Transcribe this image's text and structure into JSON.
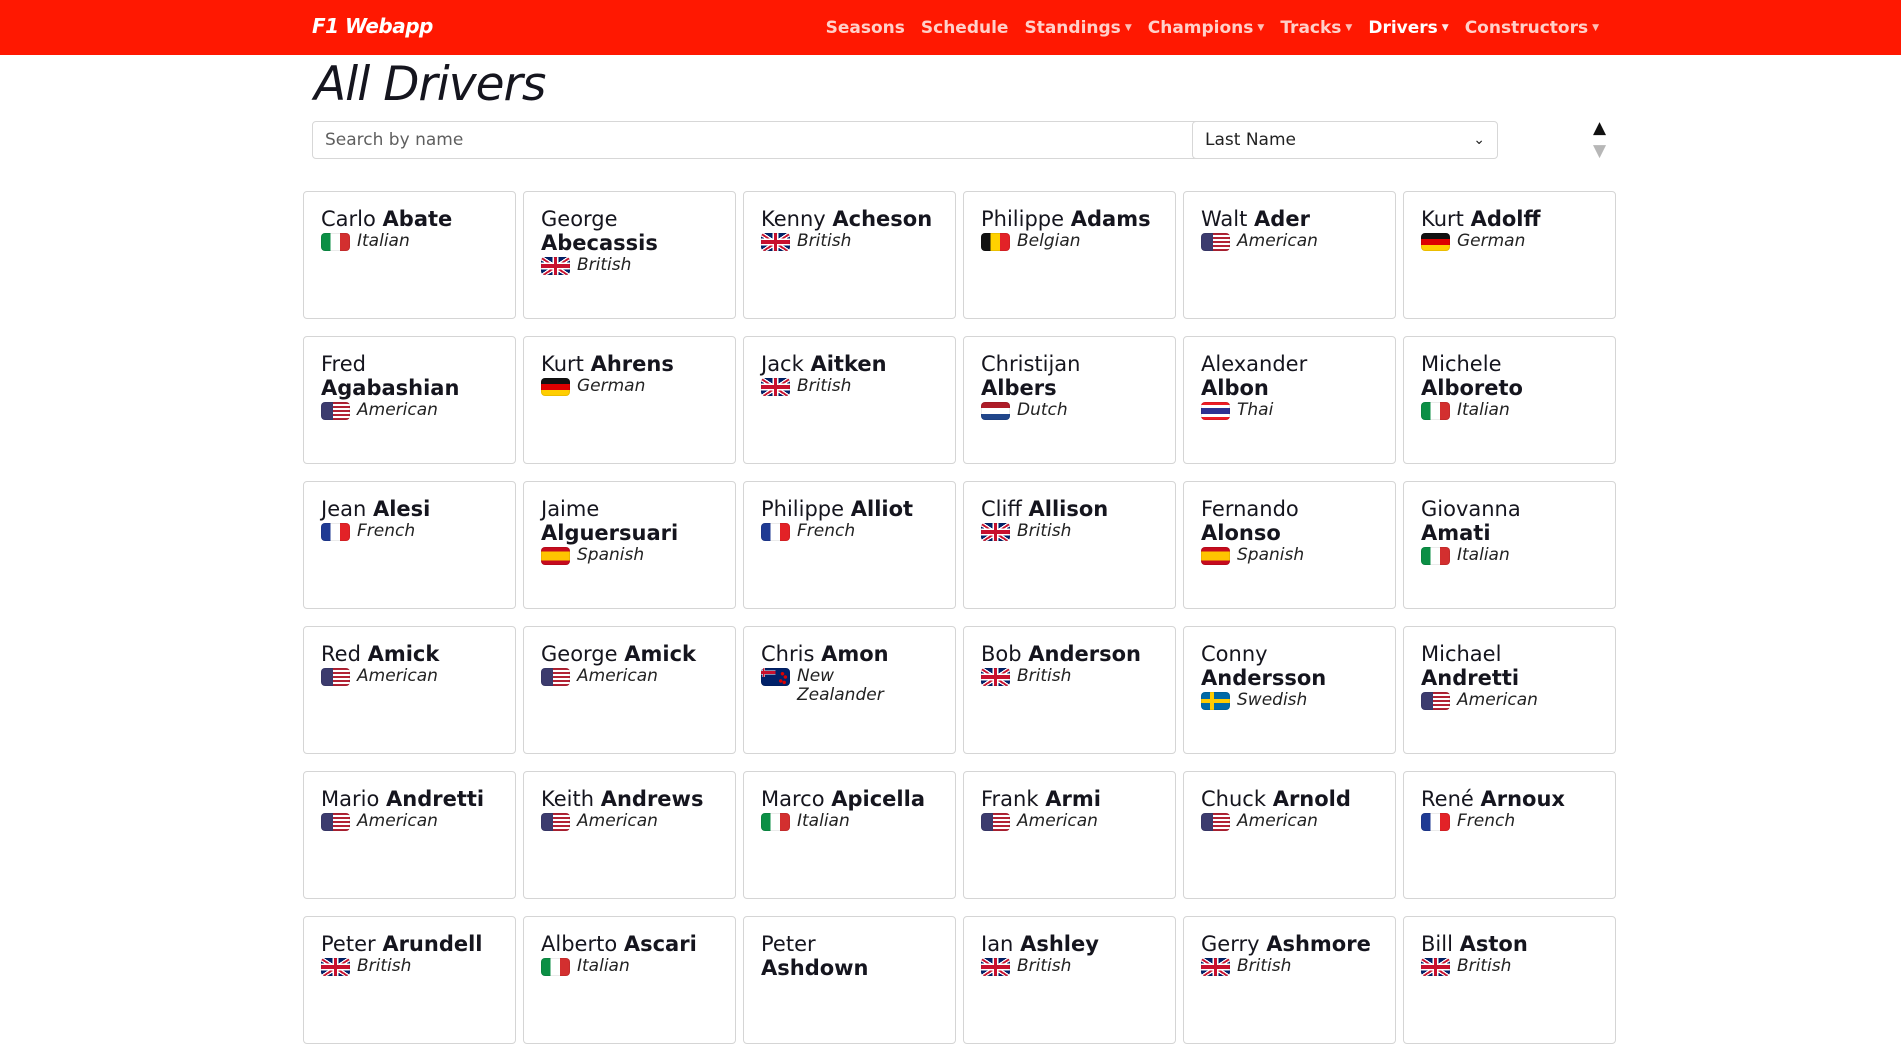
{
  "navbar": {
    "brand": "F1 Webapp",
    "items": [
      {
        "label": "Seasons",
        "dropdown": false
      },
      {
        "label": "Schedule",
        "dropdown": false
      },
      {
        "label": "Standings",
        "dropdown": true
      },
      {
        "label": "Champions",
        "dropdown": true
      },
      {
        "label": "Tracks",
        "dropdown": true
      },
      {
        "label": "Drivers",
        "dropdown": true
      },
      {
        "label": "Constructors",
        "dropdown": true
      }
    ]
  },
  "page": {
    "title": "All Drivers",
    "search_placeholder": "Search by name",
    "sort_value": "Last Name",
    "sort_asc_icon": "triangle-up-icon",
    "sort_desc_icon": "triangle-down-icon"
  },
  "colors": {
    "brand_red": "#ff1801",
    "text_dark": "#15151e",
    "card_border": "#d5d5d5"
  },
  "drivers": [
    {
      "first": "Carlo",
      "last": "Abate",
      "nationality": "Italian",
      "flag": "it"
    },
    {
      "first": "George",
      "last": "Abecassis",
      "nationality": "British",
      "flag": "gb"
    },
    {
      "first": "Kenny",
      "last": "Acheson",
      "nationality": "British",
      "flag": "gb"
    },
    {
      "first": "Philippe",
      "last": "Adams",
      "nationality": "Belgian",
      "flag": "be"
    },
    {
      "first": "Walt",
      "last": "Ader",
      "nationality": "American",
      "flag": "us"
    },
    {
      "first": "Kurt",
      "last": "Adolff",
      "nationality": "German",
      "flag": "de"
    },
    {
      "first": "Fred",
      "last": "Agabashian",
      "nationality": "American",
      "flag": "us"
    },
    {
      "first": "Kurt",
      "last": "Ahrens",
      "nationality": "German",
      "flag": "de"
    },
    {
      "first": "Jack",
      "last": "Aitken",
      "nationality": "British",
      "flag": "gb"
    },
    {
      "first": "Christijan",
      "last": "Albers",
      "nationality": "Dutch",
      "flag": "nl"
    },
    {
      "first": "Alexander",
      "last": "Albon",
      "nationality": "Thai",
      "flag": "th"
    },
    {
      "first": "Michele",
      "last": "Alboreto",
      "nationality": "Italian",
      "flag": "it"
    },
    {
      "first": "Jean",
      "last": "Alesi",
      "nationality": "French",
      "flag": "fr"
    },
    {
      "first": "Jaime",
      "last": "Alguersuari",
      "nationality": "Spanish",
      "flag": "es"
    },
    {
      "first": "Philippe",
      "last": "Alliot",
      "nationality": "French",
      "flag": "fr"
    },
    {
      "first": "Cliff",
      "last": "Allison",
      "nationality": "British",
      "flag": "gb"
    },
    {
      "first": "Fernando",
      "last": "Alonso",
      "nationality": "Spanish",
      "flag": "es"
    },
    {
      "first": "Giovanna",
      "last": "Amati",
      "nationality": "Italian",
      "flag": "it"
    },
    {
      "first": "Red",
      "last": "Amick",
      "nationality": "American",
      "flag": "us"
    },
    {
      "first": "George",
      "last": "Amick",
      "nationality": "American",
      "flag": "us"
    },
    {
      "first": "Chris",
      "last": "Amon",
      "nationality": "New Zealander",
      "flag": "nz"
    },
    {
      "first": "Bob",
      "last": "Anderson",
      "nationality": "British",
      "flag": "gb"
    },
    {
      "first": "Conny",
      "last": "Andersson",
      "nationality": "Swedish",
      "flag": "se"
    },
    {
      "first": "Michael",
      "last": "Andretti",
      "nationality": "American",
      "flag": "us"
    },
    {
      "first": "Mario",
      "last": "Andretti",
      "nationality": "American",
      "flag": "us"
    },
    {
      "first": "Keith",
      "last": "Andrews",
      "nationality": "American",
      "flag": "us"
    },
    {
      "first": "Marco",
      "last": "Apicella",
      "nationality": "Italian",
      "flag": "it"
    },
    {
      "first": "Frank",
      "last": "Armi",
      "nationality": "American",
      "flag": "us"
    },
    {
      "first": "Chuck",
      "last": "Arnold",
      "nationality": "American",
      "flag": "us"
    },
    {
      "first": "René",
      "last": "Arnoux",
      "nationality": "French",
      "flag": "fr"
    },
    {
      "first": "Peter",
      "last": "Arundell",
      "nationality": "British",
      "flag": "gb"
    },
    {
      "first": "Alberto",
      "last": "Ascari",
      "nationality": "Italian",
      "flag": "it"
    },
    {
      "first": "Peter",
      "last": "Ashdown",
      "nationality": "",
      "flag": ""
    },
    {
      "first": "Ian",
      "last": "Ashley",
      "nationality": "British",
      "flag": "gb"
    },
    {
      "first": "Gerry",
      "last": "Ashmore",
      "nationality": "British",
      "flag": "gb"
    },
    {
      "first": "Bill",
      "last": "Aston",
      "nationality": "British",
      "flag": "gb"
    }
  ]
}
